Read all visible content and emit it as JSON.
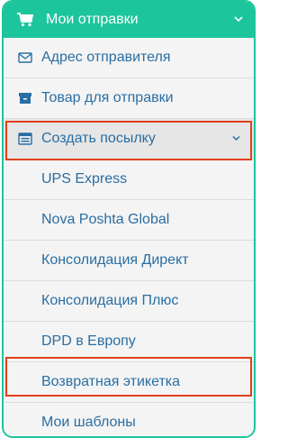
{
  "menu": {
    "header": {
      "title": "Мои отправки"
    },
    "items": [
      {
        "label": "Адрес отправителя",
        "icon": "envelope-icon"
      },
      {
        "label": "Товар для отправки",
        "icon": "archive-box-icon"
      },
      {
        "label": "Создать посылку",
        "icon": "list-alt-icon"
      }
    ],
    "subitems": [
      {
        "label": "UPS Express"
      },
      {
        "label": "Nova Poshta Global"
      },
      {
        "label": "Консолидация Директ"
      },
      {
        "label": "Консолидация Плюс"
      },
      {
        "label": "DPD в Европу"
      },
      {
        "label": "Возвратная этикетка"
      },
      {
        "label": "Мои шаблоны"
      }
    ]
  },
  "colors": {
    "accent": "#1cc59b",
    "link": "#2a6ea2",
    "highlight": "#e0401c"
  }
}
